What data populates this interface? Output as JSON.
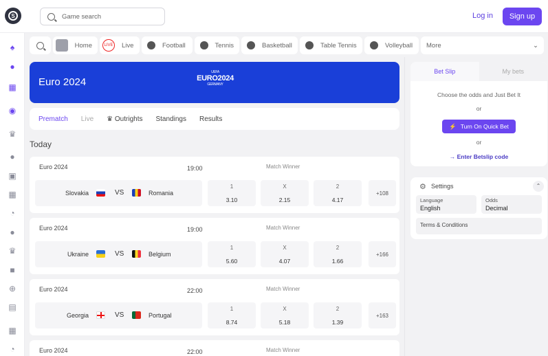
{
  "header": {
    "search_placeholder": "Game search",
    "login": "Log in",
    "signup": "Sign up",
    "logo_letter": "S"
  },
  "sport_nav": [
    {
      "label": "Home"
    },
    {
      "label": "Live",
      "badge": "LIVE"
    },
    {
      "label": "Football"
    },
    {
      "label": "Tennis"
    },
    {
      "label": "Basketball"
    },
    {
      "label": "Table Tennis"
    },
    {
      "label": "Volleyball"
    },
    {
      "label": "More"
    }
  ],
  "banner": {
    "title": "Euro 2024",
    "logo_top": "UEFA",
    "logo_main": "EURO2024",
    "logo_sub": "GERMANY"
  },
  "tabs": [
    "Prematch",
    "Live",
    "Outrights",
    "Standings",
    "Results"
  ],
  "section_title": "Today",
  "matches": [
    {
      "league": "Euro 2024",
      "time": "19:00",
      "market": "Match Winner",
      "home": "Slovakia",
      "away": "Romania",
      "vs": "VS",
      "odds": [
        {
          "label": "1",
          "value": "3.10"
        },
        {
          "label": "X",
          "value": "2.15"
        },
        {
          "label": "2",
          "value": "4.17"
        }
      ],
      "more": "+108"
    },
    {
      "league": "Euro 2024",
      "time": "19:00",
      "market": "Match Winner",
      "home": "Ukraine",
      "away": "Belgium",
      "vs": "VS",
      "odds": [
        {
          "label": "1",
          "value": "5.60"
        },
        {
          "label": "X",
          "value": "4.07"
        },
        {
          "label": "2",
          "value": "1.66"
        }
      ],
      "more": "+166"
    },
    {
      "league": "Euro 2024",
      "time": "22:00",
      "market": "Match Winner",
      "home": "Georgia",
      "away": "Portugal",
      "vs": "VS",
      "odds": [
        {
          "label": "1",
          "value": "8.74"
        },
        {
          "label": "X",
          "value": "5.18"
        },
        {
          "label": "2",
          "value": "1.39"
        }
      ],
      "more": "+163"
    },
    {
      "league": "Euro 2024",
      "time": "22:00",
      "market": "Match Winner"
    }
  ],
  "betslip": {
    "tab_betslip": "Bet Slip",
    "tab_mybets": "My bets",
    "prompt": "Choose the odds and Just Bet It",
    "or1": "or",
    "quick_bet": "Turn On Quick Bet",
    "or2": "or",
    "betslip_code": "→ Enter Betslip code"
  },
  "settings": {
    "title": "Settings",
    "language_label": "Language",
    "language_value": "English",
    "odds_label": "Odds",
    "odds_value": "Decimal",
    "terms": "Terms & Conditions"
  },
  "colors": {
    "accent": "#6b46f0",
    "banner": "#1a3fd8"
  }
}
